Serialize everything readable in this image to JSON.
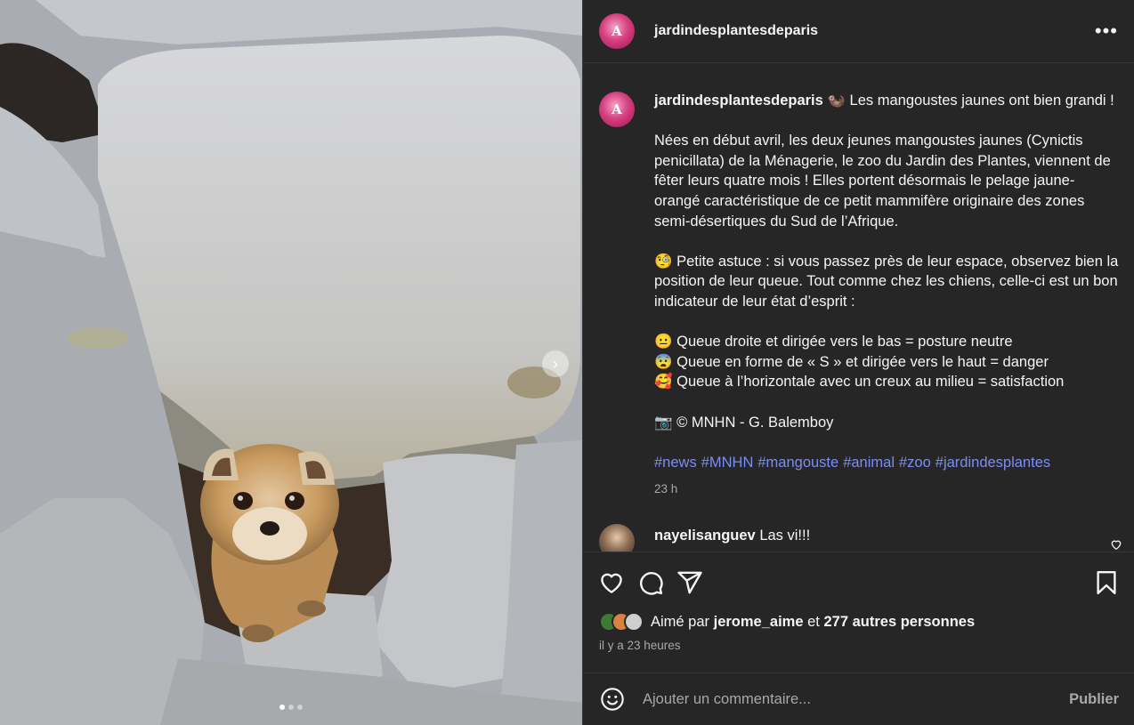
{
  "account": {
    "username": "jardindesplantesdeparis",
    "avatar_initials": "A"
  },
  "media": {
    "next_icon": "chevron-right-icon",
    "carousel_pages": 3,
    "active_page": 1
  },
  "caption": {
    "username": "jardindesplantesdeparis",
    "first_line": "🦦 Les mangoustes jaunes ont bien grandi !",
    "paragraph_1": "Nées en début avril, les deux jeunes mangoustes jaunes (Cynictis penicillata) de la Ménagerie, le zoo du Jardin des Plantes, viennent de fêter leurs quatre mois ! Elles portent désormais le pelage jaune-orangé caractéristique de ce petit mammifère originaire des zones semi-désertiques du Sud de l’Afrique.",
    "paragraph_2": "🧐 Petite astuce : si vous passez près de leur espace, observez bien la position de leur queue. Tout comme chez les chiens, celle-ci est un bon indicateur de leur état d’esprit :",
    "tail_1": "😐 Queue droite et dirigée vers le bas = posture neutre",
    "tail_2": "😨 Queue en forme de « S » et dirigée vers le haut = danger",
    "tail_3": "🥰 Queue à l’horizontale avec un creux au milieu = satisfaction",
    "credit": "📷 © MNHN - G. Balemboy",
    "hashtags": [
      "#news",
      "#MNHN",
      "#mangouste",
      "#animal",
      "#zoo",
      "#jardindesplantes"
    ],
    "time": "23 h"
  },
  "comments": [
    {
      "username": "nayelisanguev",
      "text": "Las vi!!!"
    }
  ],
  "likes": {
    "prefix": "Aimé par",
    "user": "jerome_aime",
    "joiner": "et",
    "others": "277 autres personnes"
  },
  "posted_ago": "il y a 23 heures",
  "comment_box": {
    "placeholder": "Ajouter un commentaire...",
    "publish_label": "Publier"
  }
}
